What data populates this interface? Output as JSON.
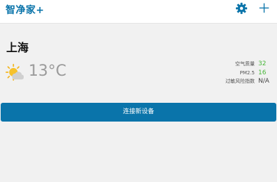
{
  "header": {
    "app_title": "智净家+",
    "settings_icon": "gear-icon",
    "add_icon": "plus-icon",
    "accent_color": "#0a74aa"
  },
  "location": {
    "city": "上海"
  },
  "weather": {
    "icon": "partly-sunny-icon",
    "temperature": "13°C"
  },
  "air_metrics": [
    {
      "label": "空气质量",
      "value": "32",
      "color": "#47b638"
    },
    {
      "label": "PM2.5",
      "value": "16",
      "color": "#47b638"
    },
    {
      "label": "过敏风险指数",
      "value": "N/A",
      "color": "#444444"
    }
  ],
  "actions": {
    "connect_label": "连接新设备"
  }
}
